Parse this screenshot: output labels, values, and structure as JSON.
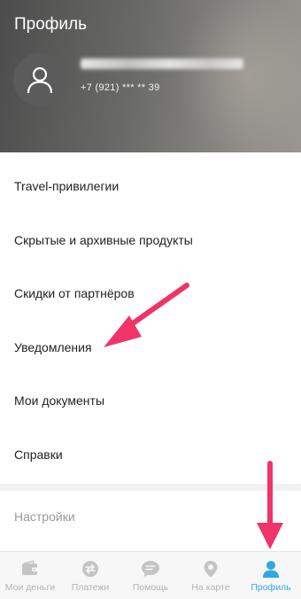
{
  "header": {
    "title": "Профиль",
    "phone": "+7 (921) *** ** 39"
  },
  "menu": {
    "items": [
      {
        "label": "Travel-привилегии"
      },
      {
        "label": "Скрытые и архивные продукты"
      },
      {
        "label": "Скидки от партнёров"
      },
      {
        "label": "Уведомления"
      },
      {
        "label": "Мои документы"
      },
      {
        "label": "Справки"
      }
    ]
  },
  "settings": {
    "label": "Настройки"
  },
  "tabbar": {
    "items": [
      {
        "label": "Мои деньги",
        "icon": "wallet-icon"
      },
      {
        "label": "Платежи",
        "icon": "transfer-icon"
      },
      {
        "label": "Помощь",
        "icon": "chat-icon"
      },
      {
        "label": "На карте",
        "icon": "map-pin-icon"
      },
      {
        "label": "Профиль",
        "icon": "profile-icon",
        "active": true
      }
    ]
  },
  "colors": {
    "accent": "#33a7df",
    "annotation_arrow": "#f0346a",
    "inactive_tab": "#b3b3b3"
  }
}
